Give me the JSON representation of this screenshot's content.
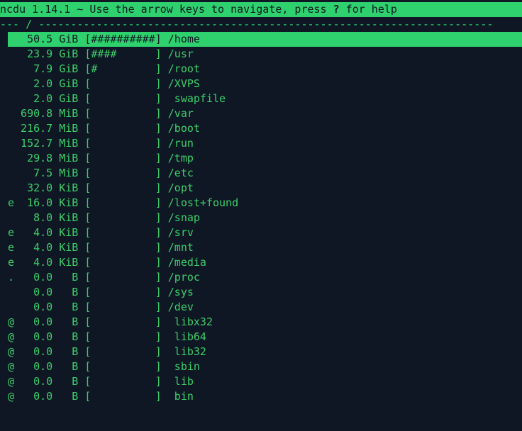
{
  "header": {
    "prefix": "ncdu 1.14.1 ~ Use the arrow keys to navigate, press ",
    "help_key": "?",
    "suffix": " for help"
  },
  "path_line": "--- / -----------------------------------------------------------------------",
  "colors": {
    "background": "#0f1724",
    "accent": "#2fd16f",
    "text": "#3ccf6a"
  },
  "rows": [
    {
      "flag": " ",
      "size": "  50.5",
      "unit": "GiB",
      "bar": "##########",
      "name": "/home",
      "selected": true
    },
    {
      "flag": " ",
      "size": "  23.9",
      "unit": "GiB",
      "bar": "####      ",
      "name": "/usr",
      "selected": false
    },
    {
      "flag": " ",
      "size": "   7.9",
      "unit": "GiB",
      "bar": "#         ",
      "name": "/root",
      "selected": false
    },
    {
      "flag": " ",
      "size": "   2.0",
      "unit": "GiB",
      "bar": "          ",
      "name": "/XVPS",
      "selected": false
    },
    {
      "flag": " ",
      "size": "   2.0",
      "unit": "GiB",
      "bar": "          ",
      "name": " swapfile",
      "selected": false
    },
    {
      "flag": " ",
      "size": " 690.8",
      "unit": "MiB",
      "bar": "          ",
      "name": "/var",
      "selected": false
    },
    {
      "flag": " ",
      "size": " 216.7",
      "unit": "MiB",
      "bar": "          ",
      "name": "/boot",
      "selected": false
    },
    {
      "flag": " ",
      "size": " 152.7",
      "unit": "MiB",
      "bar": "          ",
      "name": "/run",
      "selected": false
    },
    {
      "flag": " ",
      "size": "  29.8",
      "unit": "MiB",
      "bar": "          ",
      "name": "/tmp",
      "selected": false
    },
    {
      "flag": " ",
      "size": "   7.5",
      "unit": "MiB",
      "bar": "          ",
      "name": "/etc",
      "selected": false
    },
    {
      "flag": " ",
      "size": "  32.0",
      "unit": "KiB",
      "bar": "          ",
      "name": "/opt",
      "selected": false
    },
    {
      "flag": "e",
      "size": "  16.0",
      "unit": "KiB",
      "bar": "          ",
      "name": "/lost+found",
      "selected": false
    },
    {
      "flag": " ",
      "size": "   8.0",
      "unit": "KiB",
      "bar": "          ",
      "name": "/snap",
      "selected": false
    },
    {
      "flag": "e",
      "size": "   4.0",
      "unit": "KiB",
      "bar": "          ",
      "name": "/srv",
      "selected": false
    },
    {
      "flag": "e",
      "size": "   4.0",
      "unit": "KiB",
      "bar": "          ",
      "name": "/mnt",
      "selected": false
    },
    {
      "flag": "e",
      "size": "   4.0",
      "unit": "KiB",
      "bar": "          ",
      "name": "/media",
      "selected": false
    },
    {
      "flag": ".",
      "size": "   0.0",
      "unit": "  B",
      "bar": "          ",
      "name": "/proc",
      "selected": false
    },
    {
      "flag": " ",
      "size": "   0.0",
      "unit": "  B",
      "bar": "          ",
      "name": "/sys",
      "selected": false
    },
    {
      "flag": " ",
      "size": "   0.0",
      "unit": "  B",
      "bar": "          ",
      "name": "/dev",
      "selected": false
    },
    {
      "flag": "@",
      "size": "   0.0",
      "unit": "  B",
      "bar": "          ",
      "name": " libx32",
      "selected": false
    },
    {
      "flag": "@",
      "size": "   0.0",
      "unit": "  B",
      "bar": "          ",
      "name": " lib64",
      "selected": false
    },
    {
      "flag": "@",
      "size": "   0.0",
      "unit": "  B",
      "bar": "          ",
      "name": " lib32",
      "selected": false
    },
    {
      "flag": "@",
      "size": "   0.0",
      "unit": "  B",
      "bar": "          ",
      "name": " sbin",
      "selected": false
    },
    {
      "flag": "@",
      "size": "   0.0",
      "unit": "  B",
      "bar": "          ",
      "name": " lib",
      "selected": false
    },
    {
      "flag": "@",
      "size": "   0.0",
      "unit": "  B",
      "bar": "          ",
      "name": " bin",
      "selected": false
    }
  ]
}
